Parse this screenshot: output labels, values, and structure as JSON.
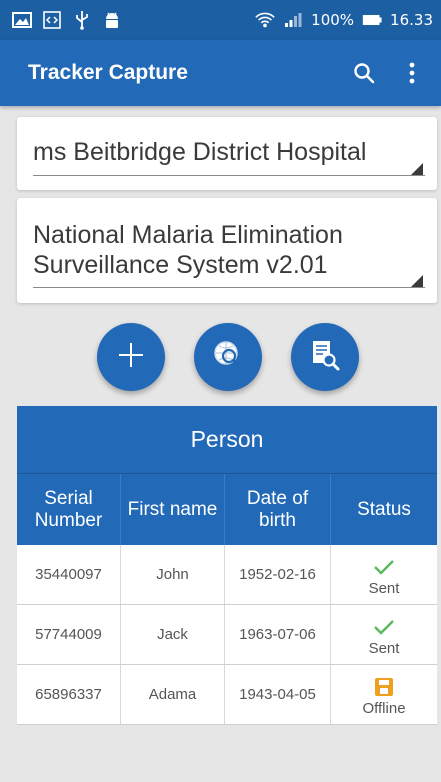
{
  "status_bar": {
    "battery": "100%",
    "time": "16.33",
    "icons": [
      "image-icon",
      "code-icon",
      "usb-icon",
      "android-icon",
      "wifi-icon",
      "signal-icon",
      "battery-icon"
    ]
  },
  "app_bar": {
    "title": "Tracker Capture",
    "actions": [
      "search-icon",
      "more-vert-icon"
    ]
  },
  "org_unit": {
    "selected": "ms Beitbridge District Hospital"
  },
  "program": {
    "selected": "National Malaria Elimination Surveillance System v2.01"
  },
  "fab_buttons": [
    "add-icon",
    "search-globe-icon",
    "report-search-icon"
  ],
  "table": {
    "title": "Person",
    "columns": [
      "Serial Number",
      "First name",
      "Date of birth",
      "Status"
    ],
    "rows": [
      {
        "serial": "35440097",
        "first_name": "John",
        "dob": "1952-02-16",
        "status": "Sent",
        "status_icon": "check-icon"
      },
      {
        "serial": "57744009",
        "first_name": "Jack",
        "dob": "1963-07-06",
        "status": "Sent",
        "status_icon": "check-icon"
      },
      {
        "serial": "65896337",
        "first_name": "Adama",
        "dob": "1943-04-05",
        "status": "Offline",
        "status_icon": "save-icon"
      }
    ]
  },
  "colors": {
    "status_bar": "#1d5fa3",
    "primary": "#2269b8",
    "sent": "#5cb85c",
    "offline": "#f0a020"
  }
}
